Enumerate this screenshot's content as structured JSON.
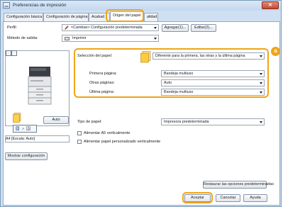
{
  "window": {
    "title": "Preferencias de impresión",
    "close_glyph": "✕"
  },
  "tabs": [
    {
      "label": "Configuración básica"
    },
    {
      "label": "Configuración de página"
    },
    {
      "label": "Acabad"
    },
    {
      "label": "Origen del papel",
      "active": true
    },
    {
      "label": "alidad"
    }
  ],
  "profile": {
    "label": "Perfil:",
    "value": "<Cambiar> Configuración predeterminada",
    "add_button": "Agregar(1)...",
    "edit_button": "Editar(2)..."
  },
  "output_method": {
    "label": "Método de salida:",
    "value": "Imprimir"
  },
  "preview": {
    "auto_button": "Auto",
    "scale_text": "A4 [Escala: Auto]",
    "show_config_button": "Mostrar configuración"
  },
  "paper_selection": {
    "label": "Selección del papel:",
    "value": "Diferente para la primera, las otras y la última página",
    "badge": "a",
    "first_page": {
      "label": "Primera página:",
      "value": "Bandeja multiuso"
    },
    "other_pages": {
      "label": "Otras páginas:",
      "value": "Auto"
    },
    "last_page": {
      "label": "Última página:",
      "value": "Bandeja multiuso"
    }
  },
  "paper_type": {
    "label": "Tipo de papel:",
    "value": "Impresora predeterminada"
  },
  "checkboxes": [
    {
      "label": "Alimentar A5 verticalmente",
      "checked": false
    },
    {
      "label": "Alimentar papel personalizado verticalmente",
      "checked": false
    }
  ],
  "footer": {
    "restore_button": "Restaurar las opciones predeterminadas",
    "accept_button": "Aceptar",
    "cancel_button": "Cancelar",
    "help_button": "Ayuda"
  },
  "colors": {
    "highlight": "#f0a418",
    "window_bg": "#cfe0f2",
    "panel_bg": "#ffffff"
  }
}
